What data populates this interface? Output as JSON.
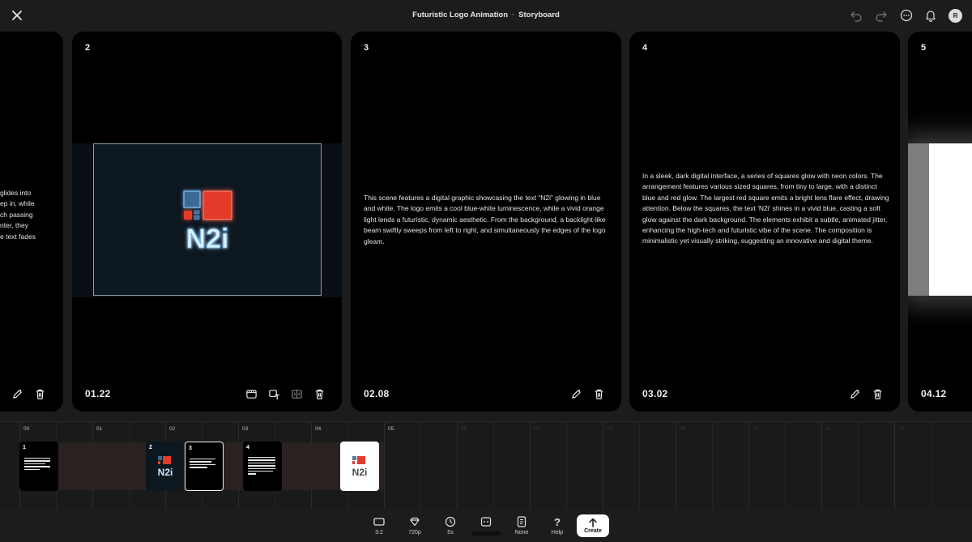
{
  "header": {
    "project_title": "Futuristic Logo Animation",
    "separator": "·",
    "view_title": "Storyboard",
    "avatar_initial": "R"
  },
  "cards": {
    "c1": {
      "desc_lines": [
        "glides into",
        "ep in, while",
        "ch passing",
        "nter, they",
        "e text fades"
      ]
    },
    "c2": {
      "number": "2",
      "time": "01.22",
      "logo_text": "N2i"
    },
    "c3": {
      "number": "3",
      "time": "02.08",
      "description": "This scene features a digital graphic showcasing the text “N2i” glowing in blue and white. The logo emits a cool blue-white luminescence, while a vivid orange light lends a futuristic, dynamic aesthetic. From the background, a backlight-like beam swiftly sweeps from left to right, and simultaneously the edges of the logo gleam."
    },
    "c4": {
      "number": "4",
      "time": "03.02",
      "description": "In a sleek, dark digital interface, a series of squares glow with neon colors. The arrangement features various sized squares, from tiny to large, with a distinct blue and red glow. The largest red square emits a bright lens flare effect, drawing attention. Below the squares, the text 'N2i' shines in a vivid blue, casting a soft glow against the dark background. The elements exhibit a subtle, animated jitter, enhancing the high-tech and futuristic vibe of the scene. The composition is minimalistic yet visually striking, suggesting an innovative and digital theme."
    },
    "c5": {
      "number": "5",
      "time": "04.12"
    }
  },
  "timeline": {
    "ruler_labels": [
      "00",
      "01",
      "02",
      "03",
      "04",
      "05",
      "06",
      "07",
      "08",
      "09",
      "10",
      "11",
      "12",
      "13"
    ],
    "thumbs": [
      {
        "number": "1"
      },
      {
        "number": "2",
        "logo_text": "N2i"
      },
      {
        "number": "3"
      },
      {
        "number": "4"
      },
      {
        "number": "",
        "logo_text": "N2i"
      }
    ]
  },
  "toolbar": {
    "aspect": "3:2",
    "quality": "720p",
    "duration": "5s",
    "style": "None",
    "help": "Help",
    "create": "Create"
  },
  "colors": {
    "background": "#1c1c1c",
    "card": "#000000",
    "logo_blue": "#5aa8e6",
    "logo_red": "#e23b2a"
  }
}
